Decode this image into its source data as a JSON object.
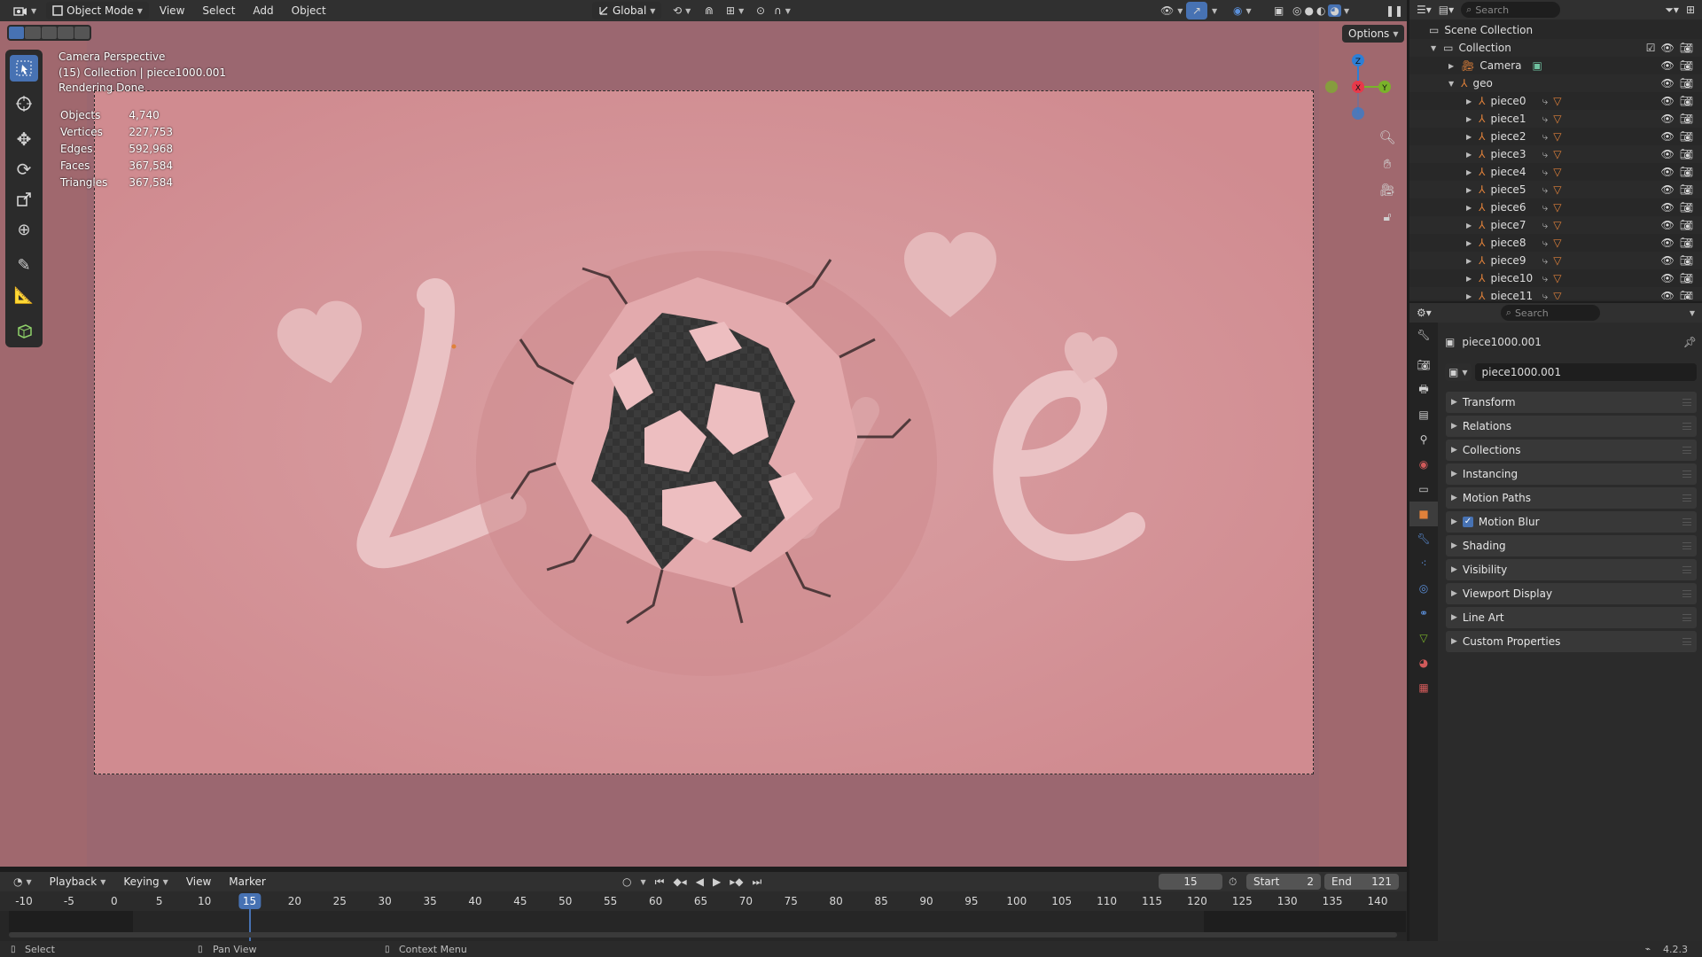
{
  "header": {
    "mode": "Object Mode",
    "menus": [
      "View",
      "Select",
      "Add",
      "Object"
    ],
    "orientation": "Global",
    "options": "Options"
  },
  "viewport": {
    "info_lines": [
      "Camera Perspective",
      "(15) Collection | piece1000.001",
      "Rendering Done"
    ],
    "stats": [
      {
        "label": "Objects",
        "value": "4,740"
      },
      {
        "label": "Vertices",
        "value": "227,753"
      },
      {
        "label": "Edges",
        "value": "592,968"
      },
      {
        "label": "Faces",
        "value": "367,584"
      },
      {
        "label": "Triangles",
        "value": "367,584"
      }
    ],
    "gizmo": {
      "x": "X",
      "y": "Y",
      "z": "Z"
    }
  },
  "timeline": {
    "menus": [
      "Playback",
      "Keying",
      "View",
      "Marker"
    ],
    "current_frame": "15",
    "start_label": "Start",
    "start": "2",
    "end_label": "End",
    "end": "121",
    "ticks": [
      "-10",
      "-5",
      "0",
      "5",
      "10",
      "15",
      "20",
      "25",
      "30",
      "35",
      "40",
      "45",
      "50",
      "55",
      "60",
      "65",
      "70",
      "75",
      "80",
      "85",
      "90",
      "95",
      "100",
      "105",
      "110",
      "115",
      "120",
      "125",
      "130",
      "135",
      "140"
    ]
  },
  "status": {
    "items": [
      "Select",
      "Pan View",
      "Context Menu"
    ],
    "version": "4.2.3"
  },
  "outliner": {
    "search_placeholder": "Search",
    "scene_collection": "Scene Collection",
    "collection": "Collection",
    "camera": "Camera",
    "geo": "geo",
    "pieces": [
      "piece0",
      "piece1",
      "piece2",
      "piece3",
      "piece4",
      "piece5",
      "piece6",
      "piece7",
      "piece8",
      "piece9",
      "piece10",
      "piece11"
    ]
  },
  "properties": {
    "search_placeholder": "Search",
    "object_name": "piece1000.001",
    "data_name": "piece1000.001",
    "panels": [
      "Transform",
      "Relations",
      "Collections",
      "Instancing",
      "Motion Paths",
      "Motion Blur",
      "Shading",
      "Visibility",
      "Viewport Display",
      "Line Art",
      "Custom Properties"
    ],
    "motion_blur_checked": true
  },
  "colors": {
    "accent": "#4772b3",
    "background_pink": "#d49094",
    "viewport_outside": "#9b6770",
    "x_axis": "#e8394a",
    "y_axis": "#7ab32a",
    "z_axis": "#2c7fd6",
    "object_orange": "#e0813a"
  }
}
